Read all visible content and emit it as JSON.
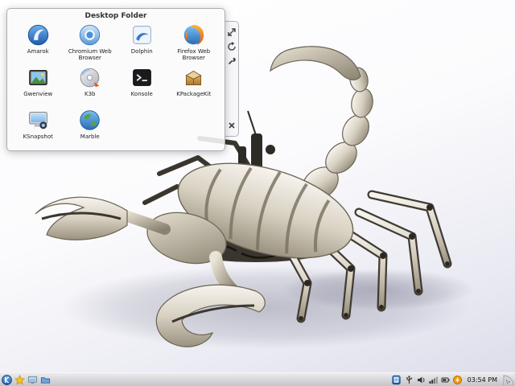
{
  "folder_view": {
    "title": "Desktop Folder",
    "items": [
      {
        "label": "Amarok"
      },
      {
        "label": "Chromium Web Browser"
      },
      {
        "label": "Dolphin"
      },
      {
        "label": "Firefox Web Browser"
      },
      {
        "label": "Gwenview"
      },
      {
        "label": "K3b"
      },
      {
        "label": "Konsole"
      },
      {
        "label": "KPackageKit"
      },
      {
        "label": "KSnapshot"
      },
      {
        "label": "Marble"
      }
    ],
    "handle_icons": [
      "resize-icon",
      "rotate-icon",
      "configure-icon",
      "close-icon"
    ]
  },
  "panel": {
    "clock": "03:54 PM",
    "left_icons": [
      "kickoff-menu-icon",
      "bookmarks-icon",
      "show-desktop-icon",
      "folder-icon"
    ],
    "tray_icons": [
      "klipper-icon",
      "device-notifier-icon",
      "volume-icon",
      "network-icon",
      "battery-icon",
      "updates-icon"
    ],
    "toolbox_icon": "panel-cashew-icon"
  },
  "wallpaper": {
    "subject": "metal-scorpion"
  },
  "colors": {
    "accent_blue": "#2a6bb8",
    "panel_bg": "#c9c9cd",
    "widget_bg": "#fbfbfc",
    "metal_light": "#f7f4ee",
    "metal_dark": "#9a927f"
  }
}
